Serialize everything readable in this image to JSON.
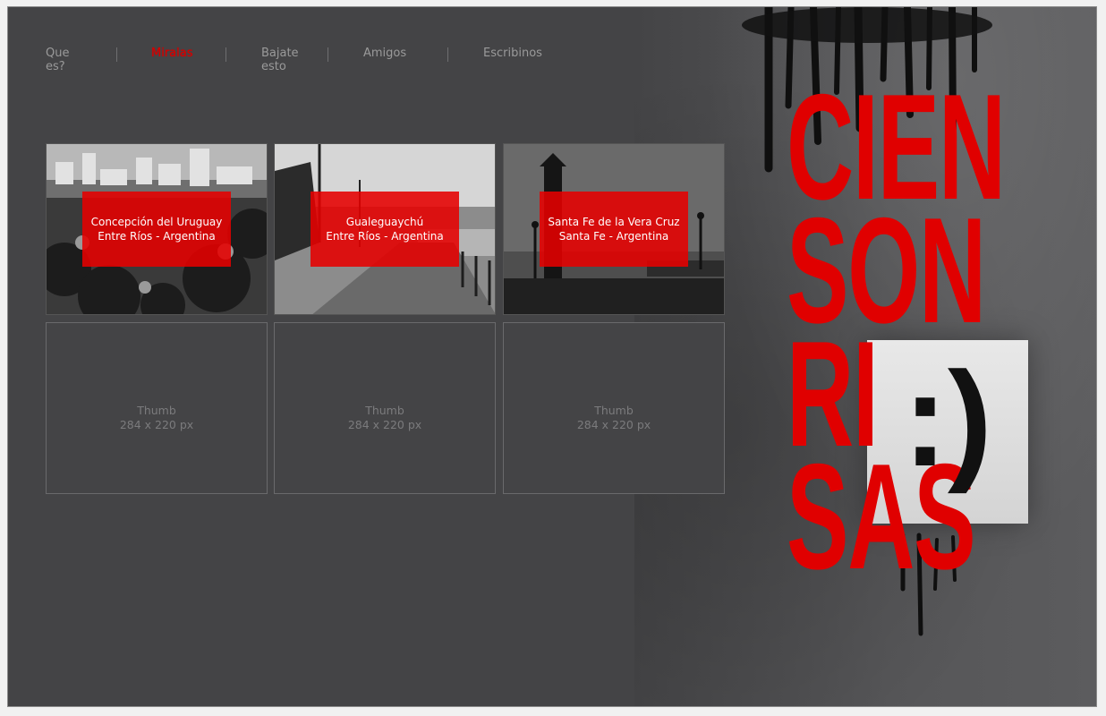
{
  "nav": {
    "items": [
      "Que es?",
      "Miralas",
      "Bajate esto",
      "Amigos",
      "Escribinos"
    ],
    "active": "Miralas"
  },
  "gallery": {
    "photos": [
      {
        "line1": "Concepción del Uruguay",
        "line2": "Entre Ríos - Argentina"
      },
      {
        "line1": "Gualeguaychú",
        "line2": "Entre Ríos - Argentina"
      },
      {
        "line1": "Santa Fe de la Vera Cruz",
        "line2": "Santa Fe - Argentina"
      }
    ],
    "placeholders": [
      {
        "line1": "Thumb",
        "line2": "284 x 220 px"
      },
      {
        "line1": "Thumb",
        "line2": "284 x 220 px"
      },
      {
        "line1": "Thumb",
        "line2": "284 x 220 px"
      }
    ]
  },
  "poster": {
    "lines": [
      "CIEN",
      "SON",
      "RI",
      "SAS"
    ],
    "smiley": ":)"
  },
  "colors": {
    "accent": "#e00000",
    "background": "#444446",
    "nav_text": "#9a9a9a"
  }
}
